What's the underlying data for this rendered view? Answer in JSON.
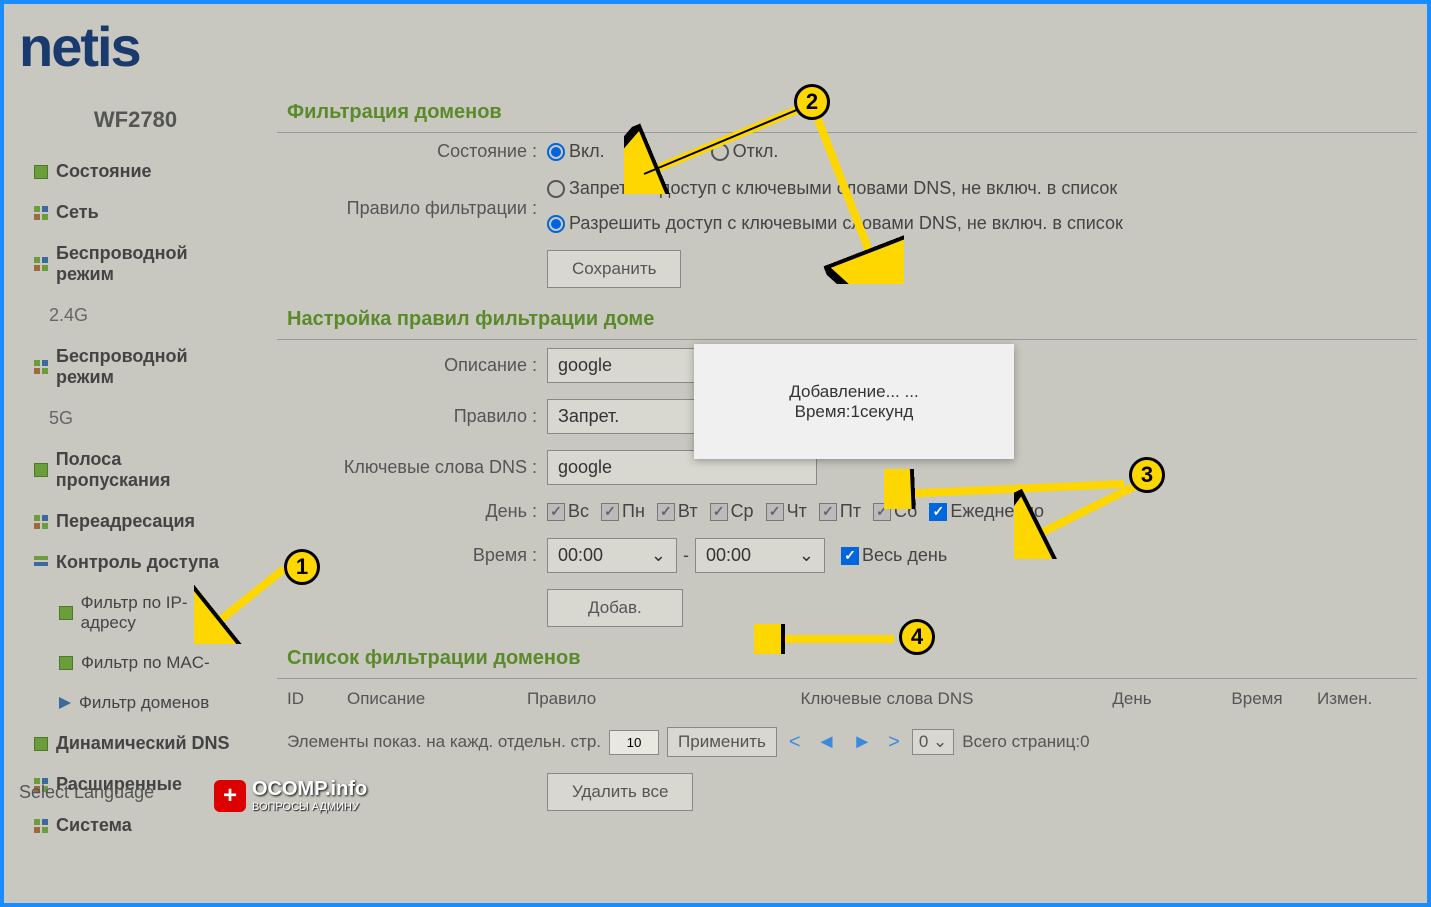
{
  "brand": "netis",
  "model": "WF2780",
  "sidebar": {
    "items": [
      {
        "label": "Состояние",
        "icon": "sq"
      },
      {
        "label": "Сеть",
        "icon": "grid"
      },
      {
        "label": "Беспроводной режим",
        "icon": "grid",
        "sub": "2.4G"
      },
      {
        "label": "Беспроводной режим",
        "icon": "grid",
        "sub": "5G"
      },
      {
        "label": "Полоса пропускания",
        "icon": "sq"
      },
      {
        "label": "Переадресация",
        "icon": "grid"
      },
      {
        "label": "Контроль доступа",
        "icon": "bars",
        "children": [
          {
            "label": "Фильтр по IP-адресу",
            "icon": "sq"
          },
          {
            "label": "Фильтр по MAC-",
            "icon": "sq"
          },
          {
            "label": "Фильтр доменов",
            "icon": "arrow"
          }
        ]
      },
      {
        "label": "Динамический DNS",
        "icon": "sq"
      },
      {
        "label": "Расширенные",
        "icon": "grid"
      },
      {
        "label": "Система",
        "icon": "grid"
      }
    ],
    "select_language": "Select Language"
  },
  "sections": {
    "domain_filter": {
      "title": "Фильтрация доменов",
      "state_label": "Состояние :",
      "state_on": "Вкл.",
      "state_off": "Откл.",
      "rule_label": "Правило фильтрации :",
      "rule_deny": "Запретить доступ с ключевыми словами DNS, не включ. в список",
      "rule_allow": "Разрешить доступ с ключевыми словами DNS, не включ. в список",
      "save_btn": "Сохранить"
    },
    "rule_setup": {
      "title": "Настройка правил фильтрации доме",
      "desc_label": "Описание :",
      "desc_value": "google",
      "rule_label": "Правило :",
      "rule_value": "Запрет.",
      "dns_label": "Ключевые слова DNS :",
      "dns_value": "google",
      "day_label": "День :",
      "days": [
        "Вс",
        "Пн",
        "Вт",
        "Ср",
        "Чт",
        "Пт",
        "Сб"
      ],
      "daily": "Ежедневно",
      "time_label": "Время :",
      "time_from": "00:00",
      "time_to": "00:00",
      "time_sep": "-",
      "all_day": "Весь день",
      "add_btn": "Добав."
    },
    "list": {
      "title": "Список фильтрации доменов",
      "cols": {
        "id": "ID",
        "desc": "Описание",
        "rule": "Правило",
        "dns": "Ключевые слова DNS",
        "day": "День",
        "time": "Время",
        "edit": "Измен."
      },
      "per_page_label": "Элементы показ. на кажд. отдельн. стр.",
      "per_page_value": "10",
      "apply_btn": "Применить",
      "page_select": "0",
      "total_label": "Всего страниц:",
      "total_value": "0",
      "delete_all": "Удалить все"
    }
  },
  "popup": {
    "line1": "Добавление... ...",
    "line2": "Время:1секунд"
  },
  "watermark": {
    "text": "OCOMP.info",
    "sub": "ВОПРОСЫ АДМИНУ"
  },
  "callouts": {
    "1": "1",
    "2": "2",
    "3": "3",
    "4": "4"
  }
}
